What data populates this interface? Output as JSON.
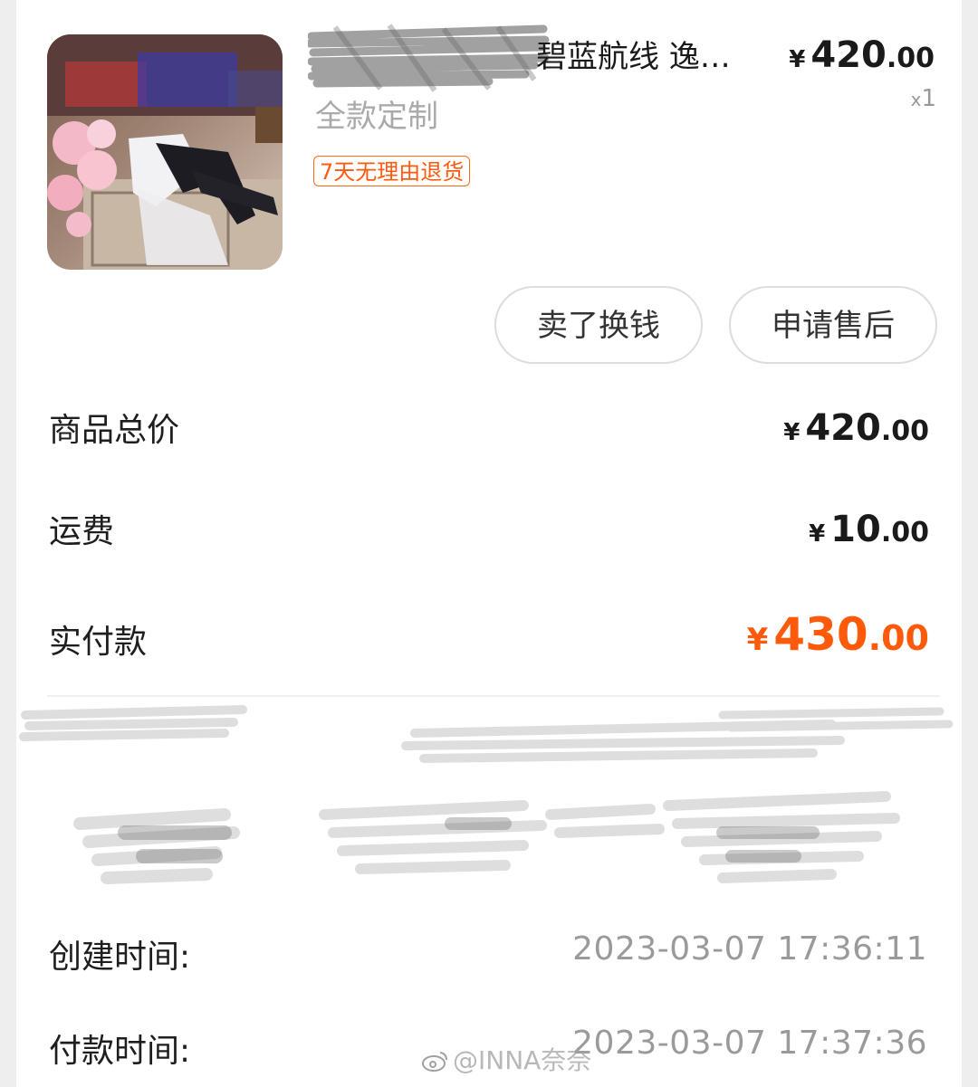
{
  "product": {
    "title": "碧蓝航线 逸…",
    "spec": "全款定制",
    "return_tag": "7天无理由退货",
    "quantity": "1",
    "quantity_prefix": "x",
    "price": {
      "currency": "¥",
      "integer": "420",
      "decimal": ".00"
    },
    "thumbnail_icon": "cosplay-photo-thumbnail"
  },
  "actions": {
    "sell_label": "卖了换钱",
    "aftersale_label": "申请售后"
  },
  "summary": {
    "goods_total_label": "商品总价",
    "goods_total": {
      "currency": "¥",
      "integer": "420",
      "decimal": ".00"
    },
    "shipping_label": "运费",
    "shipping": {
      "currency": "¥",
      "integer": "10",
      "decimal": ".00"
    },
    "paid_label": "实付款",
    "paid": {
      "currency": "¥",
      "integer": "430",
      "decimal": ".00"
    }
  },
  "times": {
    "created_label": "创建时间:",
    "created_value": "2023-03-07 17:36:11",
    "paid_label": "付款时间:",
    "paid_value": "2023-03-07 17:37:36"
  },
  "watermark": {
    "text": "@INNA奈奈",
    "icon": "weibo-logo-icon"
  },
  "colors": {
    "accent": "#ff5a0a",
    "tag_border": "#ff6a1a",
    "muted_text": "#9a9a9a",
    "background": "#eeeeee"
  }
}
